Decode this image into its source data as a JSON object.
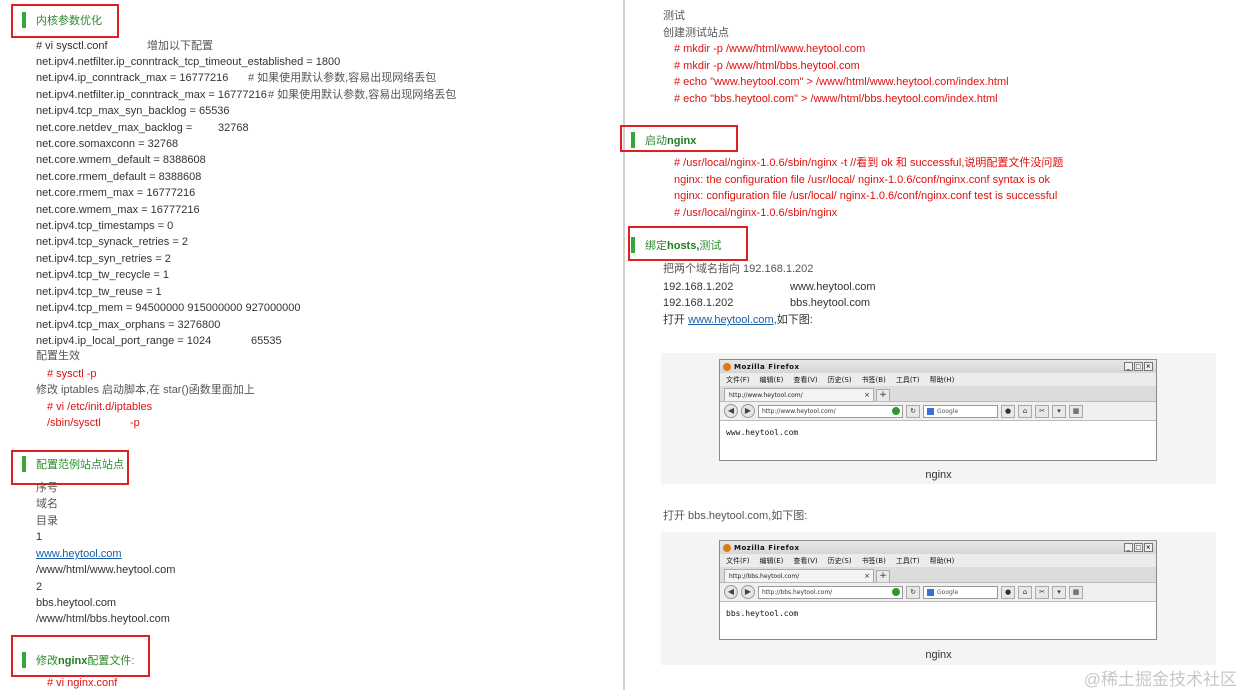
{
  "left": {
    "heading1": "内核参数优化",
    "sysctl_cmd": "# vi sysctl.conf",
    "sysctl_note": "增加以下配置",
    "params": [
      "net.ipv4.netfilter.ip_conntrack_tcp_timeout_established = 1800",
      "net.ipv4.ip_conntrack_max = 16777216",
      "net.ipv4.netfilter.ip_conntrack_max = 16777216",
      "net.ipv4.tcp_max_syn_backlog = 65536",
      "net.core.netdev_max_backlog =",
      "net.core.somaxconn = 32768",
      "net.core.wmem_default = 8388608",
      "net.core.rmem_default = 8388608",
      "net.core.rmem_max = 16777216",
      "net.core.wmem_max = 16777216",
      "net.ipv4.tcp_timestamps = 0",
      "net.ipv4.tcp_synack_retries = 2",
      "net.ipv4.tcp_syn_retries = 2",
      "net.ipv4.tcp_tw_recycle = 1",
      "net.ipv4.tcp_tw_reuse = 1",
      "net.ipv4.tcp_mem = 94500000 915000000 927000000",
      "net.ipv4.tcp_max_orphans = 3276800",
      "net.ipv4.ip_local_port_range = 1024"
    ],
    "param_notes": {
      "conntrack_note1": "#     如果使用默认参数,容易出现网络丢包",
      "conntrack_note2": "#     如果使用默认参数,容易出现网络丢包",
      "netdev_value": "32768",
      "port_range_high": "65535"
    },
    "apply_label": "配置生效",
    "apply_cmd": "# sysctl -p",
    "iptables_note": "修改 iptables 启动脚本,在 star()函数里面加上",
    "iptables_cmd1": "# vi /etc/init.d/iptables",
    "iptables_cmd2a": "/sbin/sysctl",
    "iptables_cmd2b": "-p",
    "heading2": "配置范例站点站点",
    "table_cells": [
      "序号",
      "域名",
      "目录",
      "1",
      "www.heytool.com",
      "/www/html/www.heytool.com",
      "2",
      "bbs.heytool.com",
      "/www/html/bbs.heytool.com"
    ],
    "heading3_pre": "修改",
    "heading3_bold": "nginx",
    "heading3_post": "配置文件:",
    "nginx_cmd": "# vi nginx.conf"
  },
  "right": {
    "test_label": "测试",
    "create_label": "创建测试站点",
    "create_cmds": [
      "# mkdir -p /www/html/www.heytool.com",
      "# mkdir -p /www/html/bbs.heytool.com",
      "# echo \"www.heytool.com\" > /www/html/www.heytool.com/index.html",
      "#  echo \"bbs.heytool.com\" > /www/html/bbs.heytool.com/index.html"
    ],
    "heading4_pre": "启动",
    "heading4_bold": "nginx",
    "start_cmds": [
      "# /usr/local/nginx-1.0.6/sbin/nginx -t //看到 ok 和 successful,说明配置文件没问题",
      "nginx: the configuration file /usr/local/ nginx-1.0.6/conf/nginx.conf syntax is ok",
      "nginx: configuration file /usr/local/ nginx-1.0.6/conf/nginx.conf test is successful",
      "# /usr/local/nginx-1.0.6/sbin/nginx"
    ],
    "heading5_pre": "绑定",
    "heading5_bold": "hosts,",
    "heading5_post": "测试",
    "hosts_intro": "把两个域名指向 192.168.1.202",
    "hosts": [
      {
        "ip": "192.168.1.202",
        "domain": "www.heytool.com"
      },
      {
        "ip": "192.168.1.202",
        "domain": "bbs.heytool.com"
      }
    ],
    "open1_pre": "打开",
    "open1_link": "www.heytool.com",
    "open1_post": ",如下图:",
    "open2": "打开 bbs.heytool.com,如下图:",
    "caption": "nginx"
  },
  "browser": {
    "title": "Mozilla Firefox",
    "menu": [
      "文件(F)",
      "编辑(E)",
      "查看(V)",
      "历史(S)",
      "书签(B)",
      "工具(T)",
      "帮助(H)"
    ],
    "search_placeholder": "Google",
    "shot1": {
      "url": "http://www.heytool.com/",
      "body": "www.heytool.com"
    },
    "shot2": {
      "url": "http://bbs.heytool.com/",
      "body": "bbs.heytool.com"
    }
  },
  "watermark": "@稀土掘金技术社区"
}
